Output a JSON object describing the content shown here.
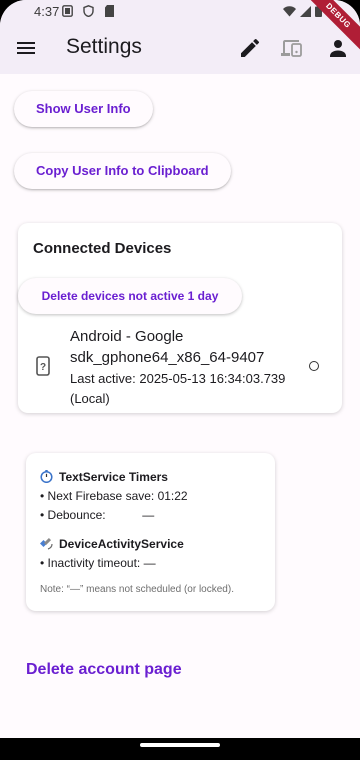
{
  "status_bar": {
    "time": "4:37",
    "left_icons": [
      "sim-card-icon",
      "shield-icon",
      "sd-card-icon"
    ],
    "right_icons": [
      "wifi-icon",
      "signal-icon",
      "battery-icon"
    ],
    "debug_banner": "DEBUG"
  },
  "app_bar": {
    "title": "Settings",
    "actions": [
      "edit-icon",
      "devices-icon",
      "account-icon"
    ],
    "tint": "#f3edf7"
  },
  "buttons": {
    "show_user_info": "Show User Info",
    "copy_user_info": "Copy User Info to Clipboard"
  },
  "connected_devices": {
    "title": "Connected Devices",
    "delete_inactive_label": "Delete devices not active 1 day",
    "devices": [
      {
        "name": "Android - Google sdk_gphone64_x86_64-9407",
        "last_active": "Last active: 2025-05-13 16:34:03.739 (Local)",
        "icon": "unknown-device-icon"
      }
    ]
  },
  "timers": {
    "text_service_title": "TextService Timers",
    "next_save": "• Next Firebase save: 01:22",
    "debounce": "• Debounce:           —",
    "device_activity_title": "DeviceActivityService",
    "inactivity_timeout": "• Inactivity timeout: —",
    "note": "Note: “—” means not scheduled (or locked)."
  },
  "delete_account_link": "Delete account page",
  "colors": {
    "accent": "#6a1fd1",
    "background": "#fffbfe"
  }
}
